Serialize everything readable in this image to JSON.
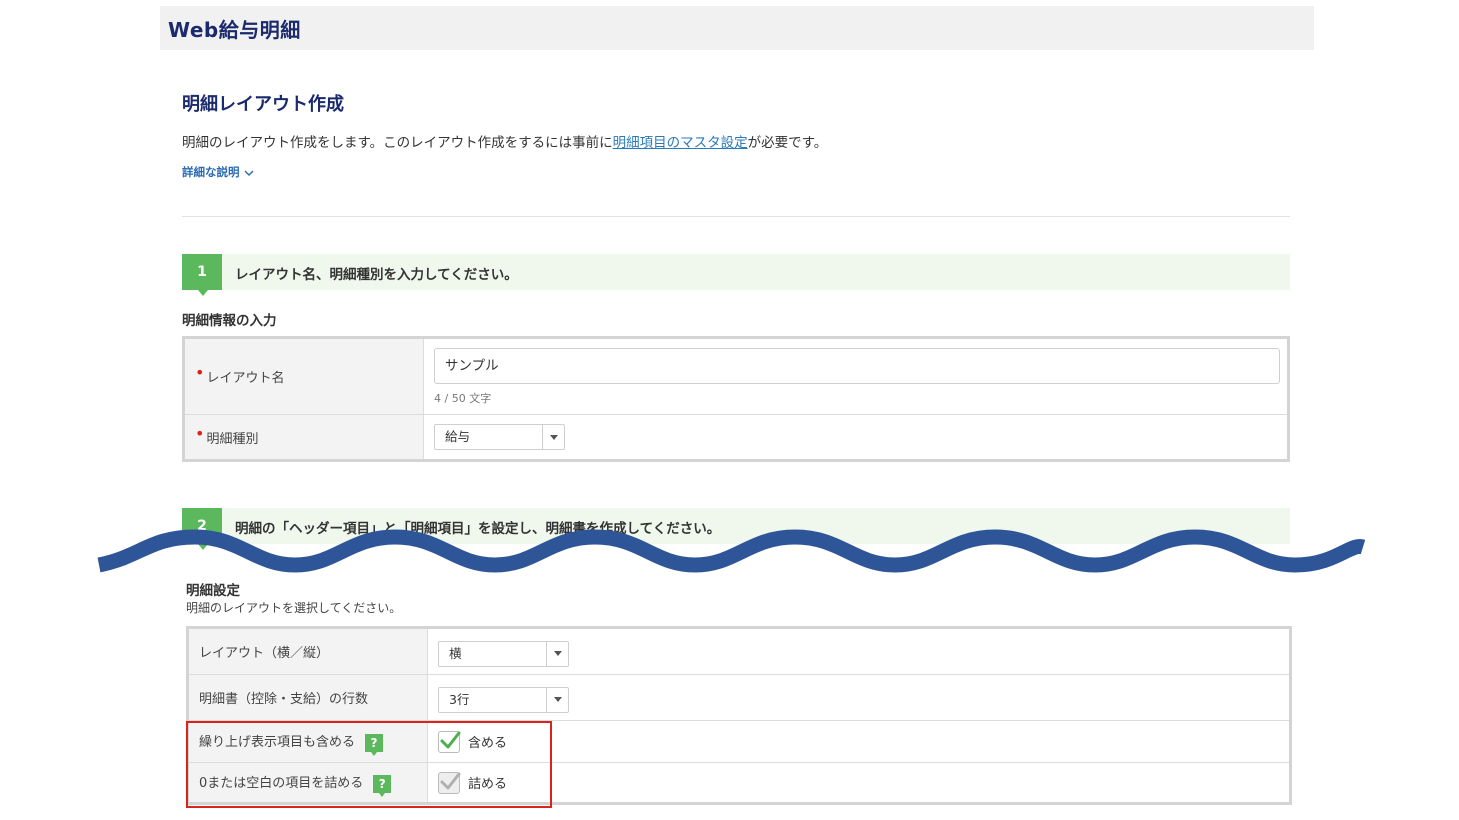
{
  "app": {
    "title": "Web給与明細"
  },
  "page": {
    "title": "明細レイアウト作成",
    "description_before": "明細のレイアウト作成をします。このレイアウト作成をするには事前に",
    "description_link": "明細項目のマスタ設定",
    "description_after": "が必要です。",
    "details_toggle": "詳細な説明"
  },
  "step1": {
    "number": "1",
    "text": "レイアウト名、明細種別を入力してください。",
    "section_title": "明細情報の入力",
    "fields": {
      "layout_name": {
        "label": "レイアウト名",
        "value": "サンプル",
        "counter": "4 / 50 文字"
      },
      "kind": {
        "label": "明細種別",
        "value": "給与"
      }
    }
  },
  "step2": {
    "number": "2",
    "text": "明細の「ヘッダー項目」と「明細項目」を設定し、明細書を作成してください。",
    "section_title": "明細設定",
    "section_desc": "明細のレイアウトを選択してください。",
    "rows": {
      "orientation": {
        "label": "レイアウト（横／縦）",
        "value": "横"
      },
      "row_count": {
        "label": "明細書（控除・支給）の行数",
        "value": "3行"
      },
      "rounding": {
        "label": "繰り上げ表示項目も含める",
        "help": "?",
        "checkbox_label": "含める",
        "checked": true
      },
      "compact": {
        "label": "0または空白の項目を詰める",
        "help": "?",
        "checkbox_label": "詰める",
        "checked": true,
        "disabled": true
      }
    }
  },
  "colors": {
    "accent_green": "#5cb85c",
    "title_navy": "#1a2a6c",
    "link_blue": "#2a7ab8",
    "wave_blue": "#2d5597",
    "highlight_red": "#d9241c"
  }
}
